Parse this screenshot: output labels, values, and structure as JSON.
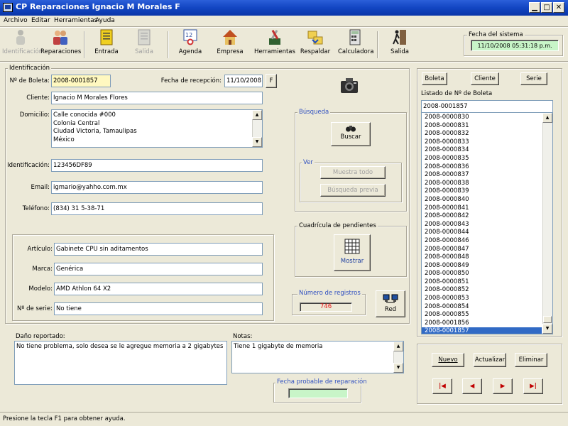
{
  "window": {
    "title": "CP Reparaciones Ignacio M Morales F"
  },
  "menu": [
    "Archivo",
    "Editar",
    "Herramientas",
    "Ayuda"
  ],
  "toolbar": [
    {
      "label": "Identificación",
      "icon": "person-icon",
      "enabled": false
    },
    {
      "label": "Reparaciones",
      "icon": "people-icon",
      "enabled": true
    },
    {
      "label": "Entrada",
      "icon": "clipboard-in-icon",
      "enabled": true
    },
    {
      "label": "Salida",
      "icon": "clipboard-out-icon",
      "enabled": false
    },
    {
      "label": "Agenda",
      "icon": "calendar-clock-icon",
      "enabled": true
    },
    {
      "label": "Empresa",
      "icon": "house-icon",
      "enabled": true
    },
    {
      "label": "Herramientas",
      "icon": "tools-icon",
      "enabled": true
    },
    {
      "label": "Respaldar",
      "icon": "backup-folder-icon",
      "enabled": true
    },
    {
      "label": "Calculadora",
      "icon": "calculator-icon",
      "enabled": true
    },
    {
      "label": "Salida",
      "icon": "exit-door-icon",
      "enabled": true
    }
  ],
  "system_date": {
    "label": "Fecha del sistema",
    "value": "11/10/2008 05:31:18 p.m."
  },
  "identificacion": {
    "group_label": "Identificación",
    "boleta_label": "Nº de Boleta:",
    "boleta_value": "2008-0001857",
    "fecha_label": "Fecha de recepción:",
    "fecha_value": "11/10/2008",
    "fecha_btn": "F",
    "cliente_label": "Cliente:",
    "cliente_value": "Ignacio M Morales Flores",
    "domicilio_label": "Domicilio:",
    "domicilio_lines": [
      "Calle conocida #000",
      "Colonia Central",
      "Ciudad Victoria, Tamaulipas",
      "México"
    ],
    "ident_label": "Identificación:",
    "ident_value": "123456DF89",
    "email_label": "Email:",
    "email_value": "igmario@yahho.com.mx",
    "tel_label": "Teléfono:",
    "tel_value": "(834) 31 5-38-71"
  },
  "articulo": {
    "articulo_label": "Artículo:",
    "articulo_value": "Gabinete CPU sin aditamentos",
    "marca_label": "Marca:",
    "marca_value": "Genérica",
    "modelo_label": "Modelo:",
    "modelo_value": "AMD Athlon 64 X2",
    "serie_label": "Nº de serie:",
    "serie_value": "No tiene"
  },
  "busqueda": {
    "group_label": "Búsqueda",
    "buscar": "Buscar",
    "ver_label": "Ver",
    "muestra_todo": "Muestra todo",
    "busqueda_previa": "Búsqueda previa"
  },
  "pendientes": {
    "group_label": "Cuadrícula de pendientes",
    "mostrar": "Mostrar"
  },
  "registros": {
    "label": "Número de registros",
    "value": "746"
  },
  "red": "Red",
  "danio": {
    "label": "Daño reportado:",
    "value": "No tiene problema, solo desea se le agregue memoria a 2 gigabytes"
  },
  "notas": {
    "label": "Notas:",
    "value": "Tiene 1 gigabyte de memoria"
  },
  "fecha_probable": {
    "label": "Fecha probable de reparación",
    "value": ""
  },
  "right": {
    "btn_boleta": "Boleta",
    "btn_cliente": "Cliente",
    "btn_serie": "Serie",
    "list_label": "Listado de Nº de Boleta",
    "search_value": "2008-0001857",
    "items": [
      "2008-0000830",
      "2008-0000831",
      "2008-0000832",
      "2008-0000833",
      "2008-0000834",
      "2008-0000835",
      "2008-0000836",
      "2008-0000837",
      "2008-0000838",
      "2008-0000839",
      "2008-0000840",
      "2008-0000841",
      "2008-0000842",
      "2008-0000843",
      "2008-0000844",
      "2008-0000846",
      "2008-0000847",
      "2008-0000848",
      "2008-0000849",
      "2008-0000850",
      "2008-0000851",
      "2008-0000852",
      "2008-0000853",
      "2008-0000854",
      "2008-0000855",
      "2008-0001856",
      "2008-0001857"
    ],
    "selected_index": 26,
    "nuevo": "Nuevo",
    "actualizar": "Actualizar",
    "eliminar": "Eliminar",
    "nav": [
      "first",
      "previous",
      "next",
      "last"
    ]
  },
  "status": "Presione la tecla F1 para obtener ayuda.",
  "colors": {
    "title_bar": "#0a36a8",
    "list_selection": "#316ac5",
    "date_field": "#c8f5c8",
    "boleta_field": "#fff8c0",
    "record_count": "#e81010"
  }
}
